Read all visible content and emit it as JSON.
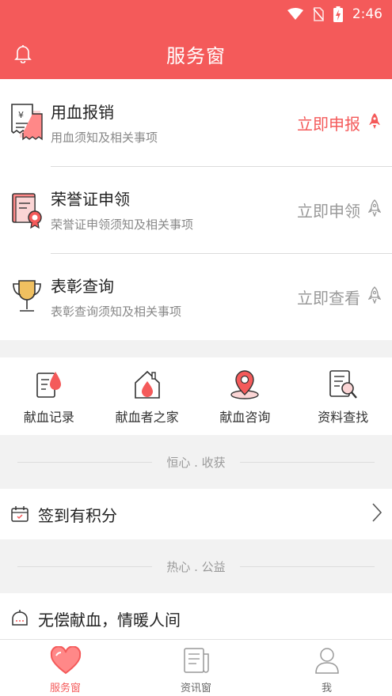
{
  "status_bar": {
    "time": "2:46",
    "icons": [
      "wifi-icon",
      "no-sim-icon",
      "battery-charging-icon"
    ]
  },
  "header": {
    "title": "服务窗",
    "left_icon": "bell-icon"
  },
  "services": [
    {
      "title": "用血报销",
      "desc": "用血须知及相关事项",
      "action": "立即申报",
      "icon": "receipt-icon",
      "action_icon": "rocket-icon",
      "active": true
    },
    {
      "title": "荣誉证申领",
      "desc": "荣誉证申领须知及相关事项",
      "action": "立即申领",
      "icon": "certificate-icon",
      "action_icon": "rocket-icon",
      "active": false
    },
    {
      "title": "表彰查询",
      "desc": "表彰查询须知及相关事项",
      "action": "立即查看",
      "icon": "trophy-icon",
      "action_icon": "rocket-icon",
      "active": false
    }
  ],
  "quick_links": [
    {
      "label": "献血记录",
      "icon": "blood-record-icon"
    },
    {
      "label": "献血者之家",
      "icon": "blood-home-icon"
    },
    {
      "label": "献血咨询",
      "icon": "location-pin-icon"
    },
    {
      "label": "资料查找",
      "icon": "document-search-icon"
    }
  ],
  "section1": {
    "label": "恒心 . 收获"
  },
  "checkin": {
    "label": "签到有积分",
    "icon": "calendar-icon",
    "chevron": "chevron-right-icon"
  },
  "section2": {
    "label": "热心 . 公益"
  },
  "charity": {
    "label": "无偿献血，情暖人间",
    "icon": "chat-bubble-icon"
  },
  "tabs": [
    {
      "label": "服务窗",
      "icon": "heart-icon",
      "active": true
    },
    {
      "label": "资讯窗",
      "icon": "news-icon",
      "active": false
    },
    {
      "label": "我",
      "icon": "user-icon",
      "active": false
    }
  ],
  "colors": {
    "brand": "#f45a5a",
    "text": "#222222",
    "muted": "#888888"
  }
}
